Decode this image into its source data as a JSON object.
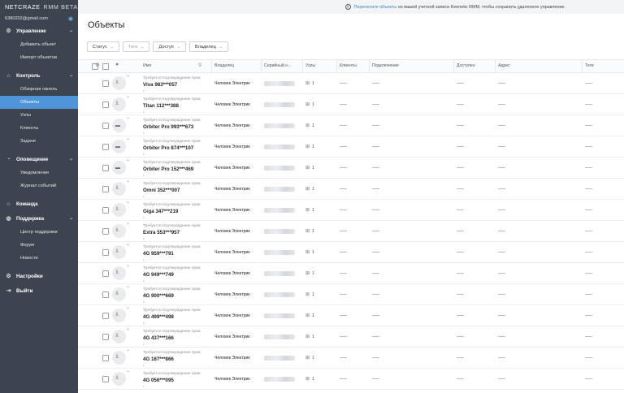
{
  "brand": {
    "name": "NETCRAZE",
    "suffix": "RMM BETA"
  },
  "account": {
    "email": "6380202@gmail.com"
  },
  "sidebar": {
    "groups": [
      {
        "label": "Управление",
        "icon": "gear-icon",
        "items": [
          {
            "label": "Добавить объект"
          },
          {
            "label": "Импорт объектов"
          }
        ]
      },
      {
        "label": "Контроль",
        "icon": "home-icon",
        "items": [
          {
            "label": "Обзорная панель"
          },
          {
            "label": "Объекты",
            "active": true
          },
          {
            "label": "Узлы"
          },
          {
            "label": "Клиенты"
          },
          {
            "label": "Задачи"
          }
        ]
      },
      {
        "label": "Оповещение",
        "icon": "bell-icon",
        "items": [
          {
            "label": "Уведомления"
          },
          {
            "label": "Журнал событий"
          }
        ]
      },
      {
        "label": "Команда",
        "icon": "team-icon",
        "items": []
      },
      {
        "label": "Поддержка",
        "icon": "support-icon",
        "items": [
          {
            "label": "Центр поддержки"
          },
          {
            "label": "Форум"
          },
          {
            "label": "Новости"
          }
        ]
      },
      {
        "label": "Настройки",
        "icon": "settings-icon",
        "items": []
      },
      {
        "label": "Выйти",
        "icon": "logout-icon",
        "items": []
      }
    ]
  },
  "banner": {
    "link": "Перенесите объекты",
    "text": "из вашей учетной записи Keenetic RMM, чтобы сохранить удаленное управление."
  },
  "page": {
    "title": "Объекты"
  },
  "filters": [
    {
      "label": "Статус",
      "disabled": false
    },
    {
      "label": "Теги",
      "disabled": true
    },
    {
      "label": "Доступ",
      "disabled": false
    },
    {
      "label": "Владелец",
      "disabled": false
    }
  ],
  "table": {
    "columns": {
      "name": "Имя",
      "owner": "Владелец",
      "serial": "Серийный н...",
      "nodes": "Узлы",
      "clients": "Клиенты",
      "connection": "Подключение",
      "access": "Доступен",
      "address": "Адрес",
      "tags": "Теги"
    },
    "pending_label": "Требуется подтверждение прав",
    "rows": [
      {
        "name": "Viva 983***057",
        "owner": "Человек Электрик",
        "nodes": "1",
        "type": "router"
      },
      {
        "name": "Titan 112***388",
        "owner": "Человек Электрик",
        "nodes": "1",
        "type": "router"
      },
      {
        "name": "Orbiter Pro 993***673",
        "owner": "Человек Электрик",
        "nodes": "1",
        "type": "ap"
      },
      {
        "name": "Orbiter Pro 874***107",
        "owner": "Человек Электрик",
        "nodes": "1",
        "type": "ap"
      },
      {
        "name": "Orbiter Pro 152***469",
        "owner": "Человек Электрик",
        "nodes": "1",
        "type": "ap"
      },
      {
        "name": "Omni 352***007",
        "owner": "Человек Электрик",
        "nodes": "1",
        "type": "router"
      },
      {
        "name": "Giga 347***219",
        "owner": "Человек Электрик",
        "nodes": "1",
        "type": "router"
      },
      {
        "name": "Extra 553***957",
        "owner": "Человек Электрик",
        "nodes": "1",
        "type": "router"
      },
      {
        "name": "4G 959***791",
        "owner": "Человек Электрик",
        "nodes": "1",
        "type": "router"
      },
      {
        "name": "4G 949***749",
        "owner": "Человек Электрик",
        "nodes": "1",
        "type": "router"
      },
      {
        "name": "4G 900***669",
        "owner": "Человек Электрик",
        "nodes": "1",
        "type": "router"
      },
      {
        "name": "4G 499***498",
        "owner": "Человек Электрик",
        "nodes": "1",
        "type": "router"
      },
      {
        "name": "4G 437***166",
        "owner": "Человек Электрик",
        "nodes": "1",
        "type": "router"
      },
      {
        "name": "4G 187***866",
        "owner": "Человек Электрик",
        "nodes": "1",
        "type": "router"
      },
      {
        "name": "4G 056***095",
        "owner": "Человек Электрик",
        "nodes": "1",
        "type": "router"
      }
    ]
  }
}
